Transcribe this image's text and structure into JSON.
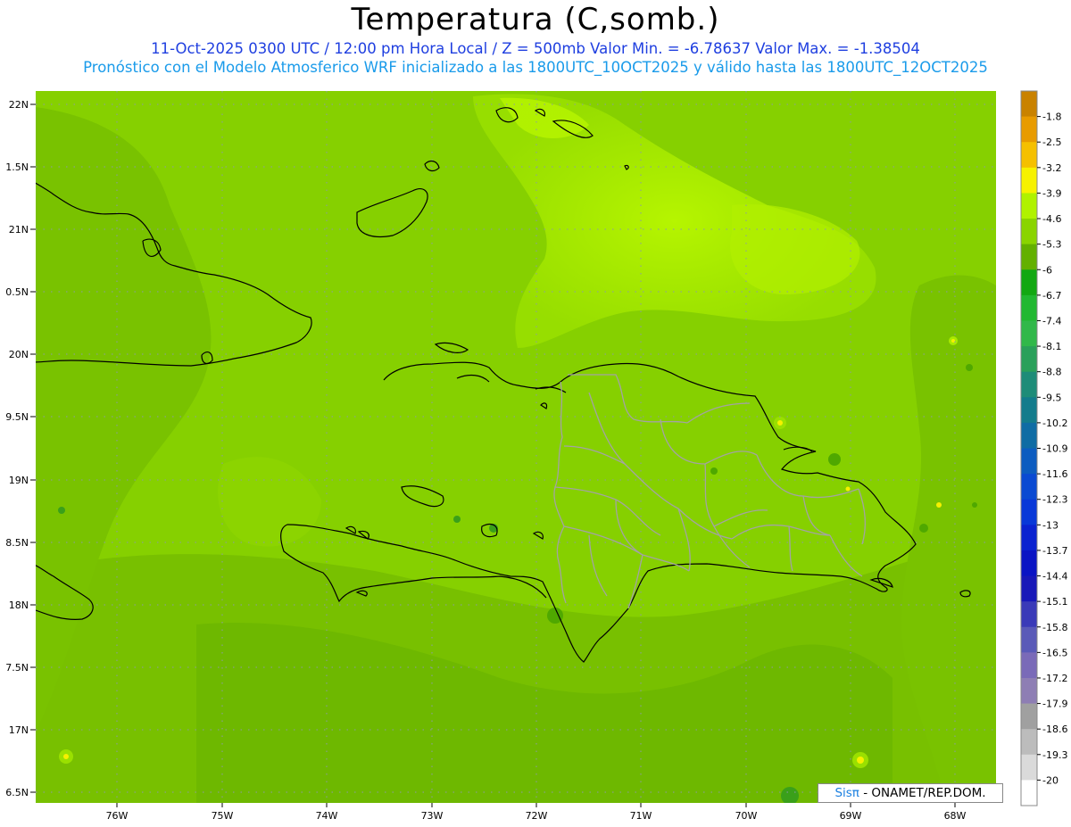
{
  "header": {
    "title": "Temperatura (C,somb.)",
    "line1": "11-Oct-2025  0300 UTC / 12:00 pm Hora Local / Z = 500mb  Valor Min. = -6.78637  Valor Max. = -1.38504",
    "line2": "Pronóstico con el Modelo Atmosferico WRF inicializado a las 1800UTC_10OCT2025 y válido hasta las  1800UTC_12OCT2025"
  },
  "axes": {
    "lat_labels": [
      "22N",
      "1.5N",
      "21N",
      "0.5N",
      "20N",
      "9.5N",
      "19N",
      "8.5N",
      "18N",
      "7.5N",
      "17N",
      "6.5N"
    ],
    "lon_labels": [
      "76W",
      "75W",
      "74W",
      "73W",
      "72W",
      "71W",
      "70W",
      "69W",
      "68W"
    ]
  },
  "colorbar": {
    "labels": [
      "-1.8",
      "-2.5",
      "-3.2",
      "-3.9",
      "-4.6",
      "-5.3",
      "-6",
      "-6.7",
      "-7.4",
      "-8.1",
      "-8.8",
      "-9.5",
      "-10.2",
      "-10.9",
      "-11.6",
      "-12.3",
      "-13",
      "-13.7",
      "-14.4",
      "-15.1",
      "-15.8",
      "-16.5",
      "-17.2",
      "-17.9",
      "-18.6",
      "-19.3",
      "-20"
    ],
    "colors": [
      "#c98200",
      "#e89b00",
      "#f5c000",
      "#f7f200",
      "#b0f200",
      "#8ad400",
      "#63b000",
      "#12a812",
      "#21b831",
      "#31b84a",
      "#2aa05a",
      "#1e8c78",
      "#137c8c",
      "#0f6ca4",
      "#0c5cc0",
      "#0a4ad2",
      "#0838d8",
      "#0a22d0",
      "#0a14c4",
      "#1818b8",
      "#3a3ab8",
      "#5a5ab8",
      "#7a6ab8",
      "#8e7eb4",
      "#a0a0a0",
      "#bcbcbc",
      "#dadada",
      "#ffffff"
    ]
  },
  "credit": {
    "brand": "Sisπ",
    "rest": " - ONAMET/REP.DOM."
  }
}
